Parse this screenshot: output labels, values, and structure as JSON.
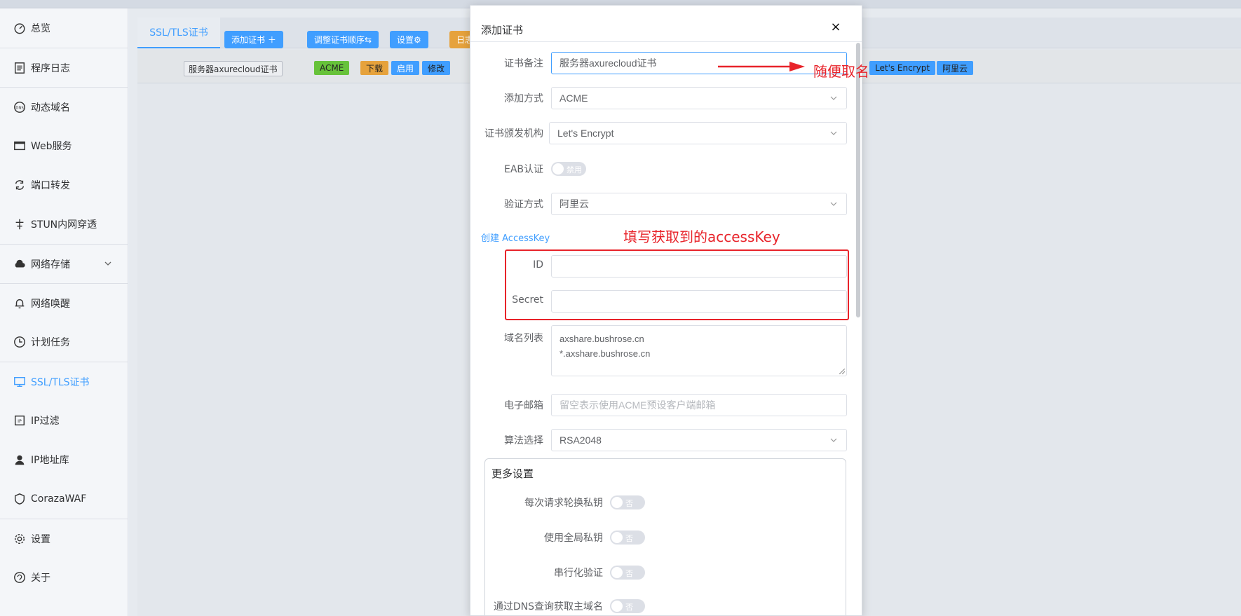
{
  "sidebar": {
    "items": [
      {
        "label": "总览",
        "icon": "dashboard-icon"
      },
      {
        "label": "程序日志",
        "icon": "log-icon"
      },
      {
        "label": "动态域名",
        "icon": "dns-icon"
      },
      {
        "label": "Web服务",
        "icon": "web-icon"
      },
      {
        "label": "端口转发",
        "icon": "port-forward-icon"
      },
      {
        "label": "STUN内网穿透",
        "icon": "stun-icon"
      },
      {
        "label": "网络存储",
        "icon": "cloud-icon"
      },
      {
        "label": "网络唤醒",
        "icon": "bell-icon"
      },
      {
        "label": "计划任务",
        "icon": "clock-icon"
      },
      {
        "label": "SSL/TLS证书",
        "icon": "certificate-icon"
      },
      {
        "label": "IP过滤",
        "icon": "ip-filter-icon"
      },
      {
        "label": "IP地址库",
        "icon": "ip-database-icon"
      },
      {
        "label": "CorazaWAF",
        "icon": "shield-icon"
      },
      {
        "label": "设置",
        "icon": "gear-icon"
      },
      {
        "label": "关于",
        "icon": "info-icon"
      }
    ],
    "active": "SSL/TLS证书"
  },
  "tabs": {
    "active_label": "SSL/TLS证书",
    "add_cert": "添加证书 ＋",
    "reorder": "调整证书顺序⇆",
    "settings": "设置⚙",
    "log": "日志"
  },
  "cert_row": {
    "name": "服务器axurecloud证书",
    "acme": "ACME",
    "download": "下载",
    "enable": "启用",
    "edit": "修改",
    "ca": "Let's Encrypt",
    "provider": "阿里云"
  },
  "modal": {
    "title": "添加证书",
    "close": "×",
    "fields": {
      "remark_label": "证书备注",
      "remark_value": "服务器axurecloud证书",
      "method_label": "添加方式",
      "method_value": "ACME",
      "ca_label": "证书颁发机构",
      "ca_value": "Let's Encrypt",
      "eab_label": "EAB认证",
      "eab_toggle": "禁用",
      "verify_label": "验证方式",
      "verify_value": "阿里云",
      "create_key_link": "创建 AccessKey",
      "id_label": "ID",
      "id_value": "",
      "secret_label": "Secret",
      "secret_value": "",
      "domains_label": "域名列表",
      "domains_line1": "axshare.bushrose.cn",
      "domains_line2": "*.axshare.bushrose.cn",
      "email_label": "电子邮箱",
      "email_placeholder": "留空表示使用ACME预设客户端邮箱",
      "algo_label": "算法选择",
      "algo_value": "RSA2048"
    },
    "more": {
      "title": "更多设置",
      "rotate_key_label": "每次请求轮换私钥",
      "global_key_label": "使用全局私钥",
      "serial_label": "串行化验证",
      "dns_label": "通过DNS查询获取主域名",
      "toggle_no": "否"
    }
  },
  "annotations": {
    "remark_note": "随便取名",
    "accesskey_note": "填写获取到的accessKey",
    "color": "#e8232a"
  }
}
